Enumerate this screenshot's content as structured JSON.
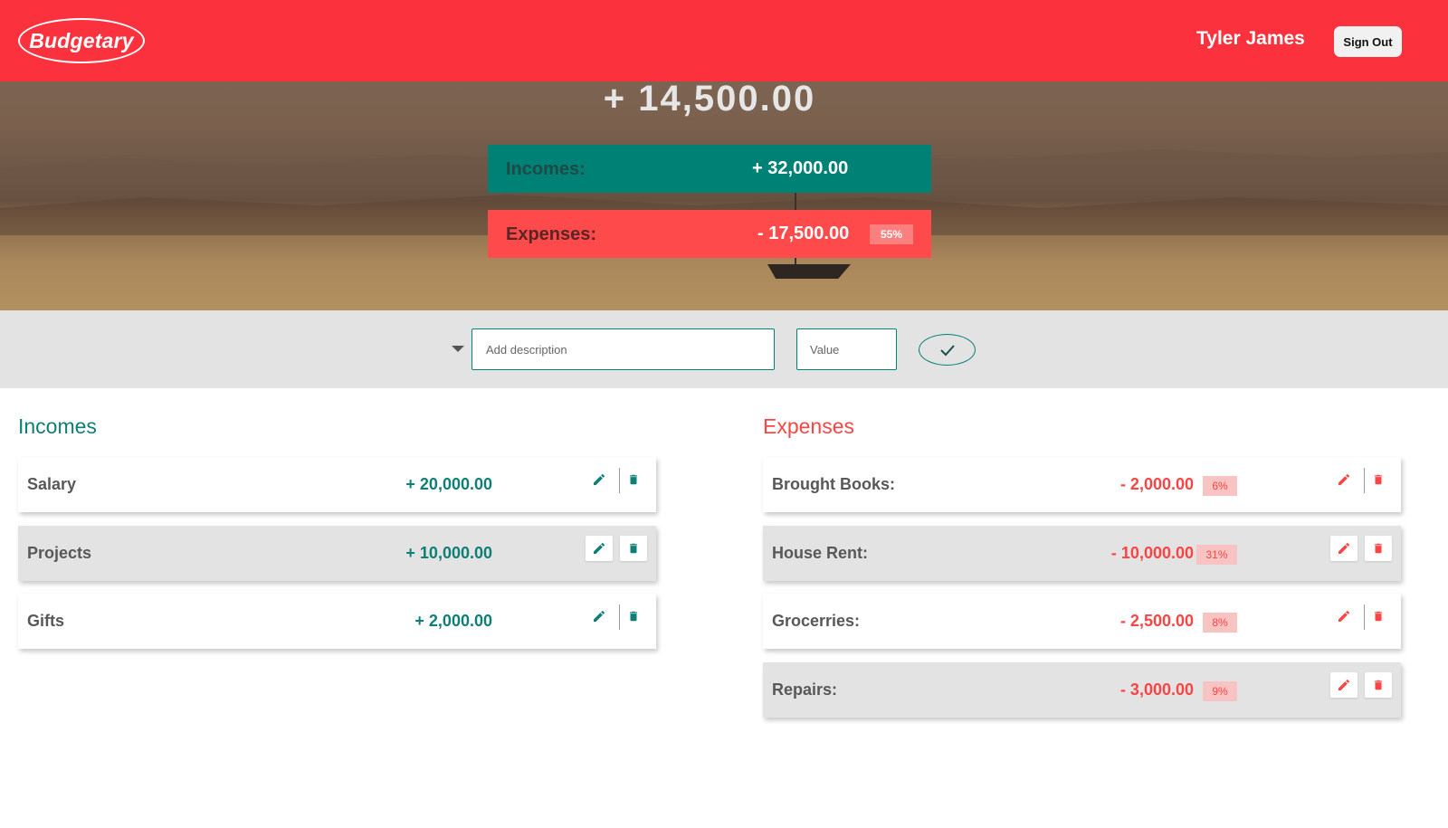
{
  "header": {
    "logo": "Budgetary",
    "user_name": "Tyler James",
    "sign_out_label": "Sign Out"
  },
  "summary": {
    "total": "+ 14,500.00",
    "incomes_label": "Incomes:",
    "incomes_value": "+ 32,000.00",
    "expenses_label": "Expenses:",
    "expenses_value": "- 17,500.00",
    "expenses_percent": "55%"
  },
  "form": {
    "description_placeholder": "Add description",
    "value_placeholder": "Value"
  },
  "incomes": {
    "title": "Incomes",
    "items": [
      {
        "description": "Salary",
        "value": "+ 20,000.00"
      },
      {
        "description": "Projects",
        "value": "+ 10,000.00"
      },
      {
        "description": "Gifts",
        "value": "+ 2,000.00"
      }
    ]
  },
  "expenses": {
    "title": "Expenses",
    "items": [
      {
        "description": "Brought Books:",
        "value": "- 2,000.00",
        "percent": "6%"
      },
      {
        "description": "House Rent:",
        "value": "- 10,000.00",
        "percent": "31%"
      },
      {
        "description": "Grocerries:",
        "value": "- 2,500.00",
        "percent": "8%"
      },
      {
        "description": "Repairs:",
        "value": "- 3,000.00",
        "percent": "9%"
      }
    ]
  },
  "colors": {
    "brand_red": "#fb323e",
    "income_teal": "#008176",
    "expense_red": "#fe4a4a",
    "input_bar": "#e3e3e3"
  },
  "icons": {
    "edit": "pencil-icon",
    "delete": "trash-icon",
    "submit": "checkmark-icon",
    "type_toggle": "caret-down-icon"
  }
}
